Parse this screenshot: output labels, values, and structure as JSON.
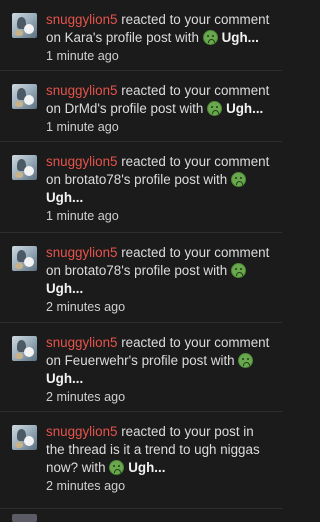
{
  "notifications": [
    {
      "user": "snuggylion5",
      "text": " reacted to your comment on Kara's profile post with ",
      "reaction": "Ugh...",
      "time": "1 minute ago"
    },
    {
      "user": "snuggylion5",
      "text": " reacted to your comment on DrMd's profile post with ",
      "reaction": "Ugh...",
      "time": "1 minute ago"
    },
    {
      "user": "snuggylion5",
      "text": " reacted to your comment on brotato78's profile post with ",
      "reaction": "Ugh...",
      "time": "1 minute ago"
    },
    {
      "user": "snuggylion5",
      "text": " reacted to your comment on brotato78's profile post with ",
      "reaction": "Ugh...",
      "time": "2 minutes ago"
    },
    {
      "user": "snuggylion5",
      "text": " reacted to your comment on Feuerwehr's profile post with ",
      "reaction": "Ugh...",
      "time": "2 minutes ago"
    },
    {
      "user": "snuggylion5",
      "text": " reacted to your post in the thread is it a trend to ugh niggas now? with ",
      "reaction": "Ugh...",
      "time": "2 minutes ago"
    }
  ],
  "colors": {
    "background": "#1b1b1b",
    "username": "#e5534b",
    "divider": "#2e2e2e",
    "reaction_emoji": "#6aa84f"
  },
  "icons": {
    "avatar": "user-avatar",
    "reaction": "ugh-emoji-icon"
  }
}
